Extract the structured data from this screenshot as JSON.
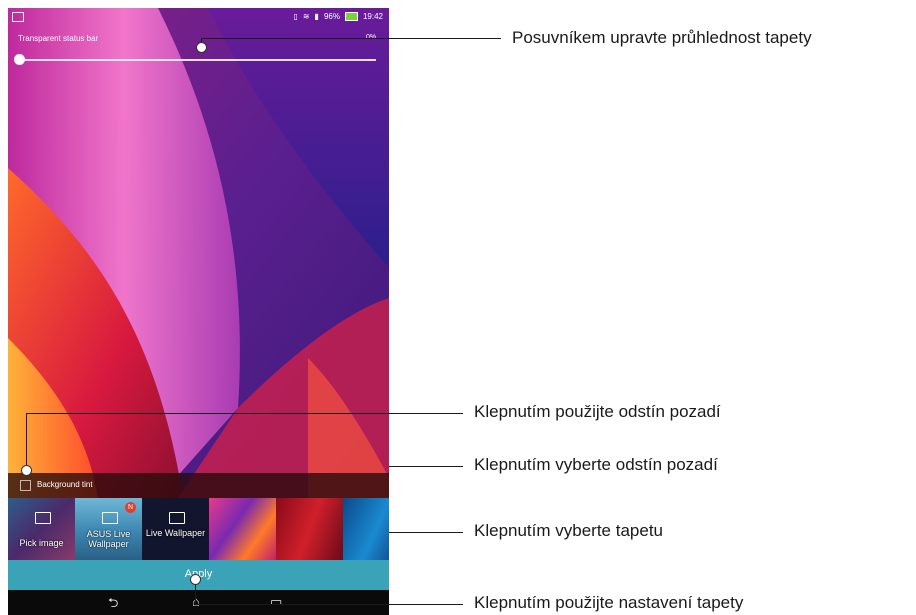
{
  "status_bar": {
    "battery": "96%",
    "time": "19:42"
  },
  "transparency": {
    "label": "Transparent status bar",
    "value": "0%"
  },
  "background_tint": {
    "label": "Background tint",
    "checked": false
  },
  "wallpapers": [
    {
      "label": "Pick image",
      "icon": "image-icon"
    },
    {
      "label": "ASUS Live Wallpaper",
      "icon": "image-icon",
      "badge": "N"
    },
    {
      "label": "Live Wallpaper",
      "icon": "image-icon"
    },
    {
      "label": ""
    },
    {
      "label": ""
    },
    {
      "label": ""
    }
  ],
  "apply": {
    "label": "Apply"
  },
  "navbar": {
    "back": "⮌",
    "home": "⌂",
    "recents": "▭"
  },
  "callouts": [
    "Posuvníkem upravte průhlednost tapety",
    "Klepnutím použijte odstín pozadí",
    "Klepnutím vyberte odstín pozadí",
    "Klepnutím vyberte tapetu",
    "Klepnutím použijte nastavení tapety"
  ],
  "colors": {
    "apply_bar": "#3aa3b7",
    "badge": "#e2402e",
    "battery": "#7bd23a"
  }
}
